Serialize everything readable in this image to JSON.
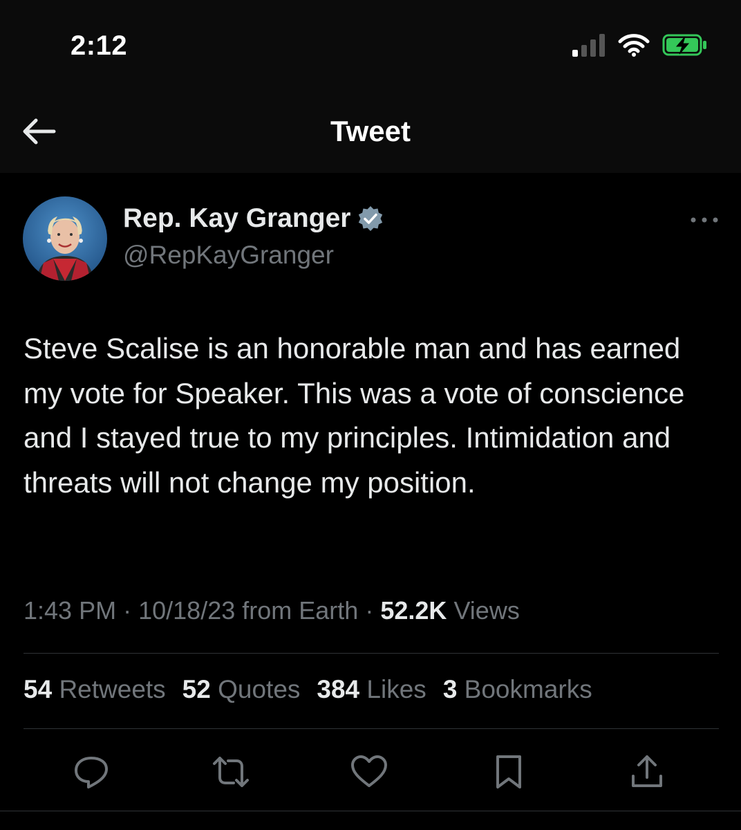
{
  "status_bar": {
    "time": "2:12",
    "icons": [
      "signal-icon",
      "wifi-icon",
      "battery-charging-icon"
    ],
    "battery_color": "#34c759"
  },
  "header": {
    "title": "Tweet",
    "back_icon": "arrow-left-icon"
  },
  "tweet": {
    "author": {
      "name": "Rep. Kay Granger",
      "handle": "@RepKayGranger",
      "verified": true,
      "verified_color": "#829aab"
    },
    "text": "Steve Scalise is an honorable man and has earned my vote for Speaker. This was a vote of conscience and I stayed true to my principles. Intimidation and threats will not change my position.",
    "time": "1:43 PM",
    "date": "10/18/23",
    "source": "from Earth",
    "views_count": "52.2K",
    "views_label": "Views",
    "separator": "·",
    "stats": [
      {
        "count": "54",
        "label": "Retweets"
      },
      {
        "count": "52",
        "label": "Quotes"
      },
      {
        "count": "384",
        "label": "Likes"
      },
      {
        "count": "3",
        "label": "Bookmarks"
      }
    ],
    "actions": [
      "reply-icon",
      "retweet-icon",
      "like-icon",
      "bookmark-icon",
      "share-icon"
    ]
  },
  "colors": {
    "background": "#000000",
    "text_primary": "#e7e9ea",
    "text_secondary": "#71767b",
    "divider": "#2f3336"
  }
}
